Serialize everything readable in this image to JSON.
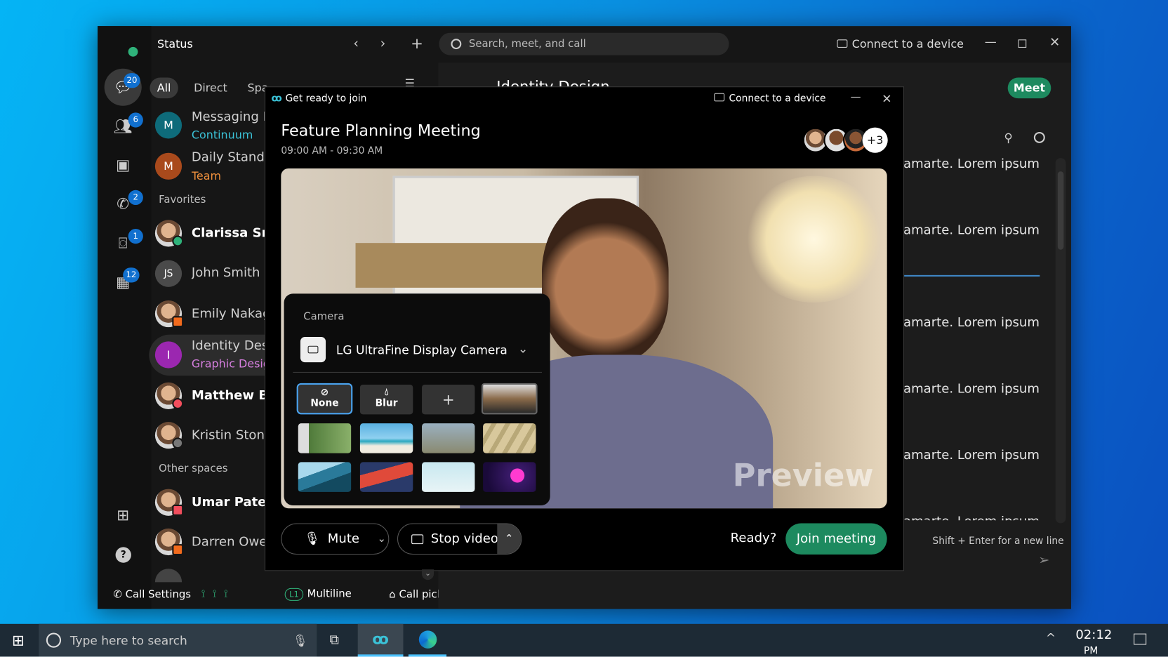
{
  "app": {
    "status_label": "Status",
    "search_placeholder": "Search, meet, and call",
    "connect_device": "Connect to a device"
  },
  "rail": {
    "badges": {
      "messaging": "20",
      "teams": "6",
      "calls": "2",
      "voicemail": "1",
      "meetings": "12"
    }
  },
  "filters": [
    "All",
    "Direct",
    "Spa"
  ],
  "list": [
    {
      "name": "Messaging Fe",
      "sub": "Continuum",
      "initial": "M",
      "color": "#0e6b7a",
      "sub_color": "#3bc3d8"
    },
    {
      "name": "Daily Stand U",
      "sub": "Team",
      "initial": "M",
      "color": "#a94a1c",
      "sub_color": "#f0903c"
    }
  ],
  "sections": {
    "favorites": "Favorites",
    "other": "Other spaces"
  },
  "favorites": [
    {
      "name": "Clarissa Smi",
      "bold": true,
      "status": "available"
    },
    {
      "name": "John Smith",
      "initials": "JS"
    },
    {
      "name": "Emily Nakaga",
      "status": "in-meeting"
    },
    {
      "name": "Identity Desi",
      "sub": "Graphic Design",
      "initial": "I",
      "color": "#9b27b0",
      "sub_color": "#d77fe0",
      "selected": true
    },
    {
      "name": "Matthew Ba",
      "bold": true,
      "status": "do-not-disturb"
    },
    {
      "name": "Kristin Stone",
      "status": "away"
    }
  ],
  "other": [
    {
      "name": "Umar Patel",
      "bold": true,
      "status": "presenting"
    },
    {
      "name": "Darren Owen",
      "status": "in-calendar-meeting"
    }
  ],
  "bottom_bar": {
    "call_settings": "Call Settings",
    "multiline_badge": "L1",
    "multiline": "Multiline",
    "call_pickup": "Call pickup"
  },
  "space": {
    "title": "Identity Design",
    "meet": "Meet",
    "message": "amarte. Lorem ipsum",
    "hint": "Shift + Enter for a new line"
  },
  "dialog": {
    "title": "Get ready to join",
    "connect_device": "Connect to a device",
    "meeting_title": "Feature Planning Meeting",
    "time": "09:00 AM - 09:30 AM",
    "extra_participants": "+3",
    "preview_label": "Preview",
    "camera": {
      "heading": "Camera",
      "device": "LG UltraFine Display Camera",
      "none": "None",
      "blur": "Blur",
      "add": "+"
    },
    "mute": "Mute",
    "stop_video": "Stop video",
    "ready": "Ready?",
    "join": "Join meeting"
  },
  "taskbar": {
    "search_placeholder": "Type here to search",
    "time": "02:12",
    "ampm": "PM"
  },
  "colors": {
    "accent_green": "#1d8a5f",
    "badge_blue": "#1170cf",
    "selected_border": "#4aa3ef"
  }
}
